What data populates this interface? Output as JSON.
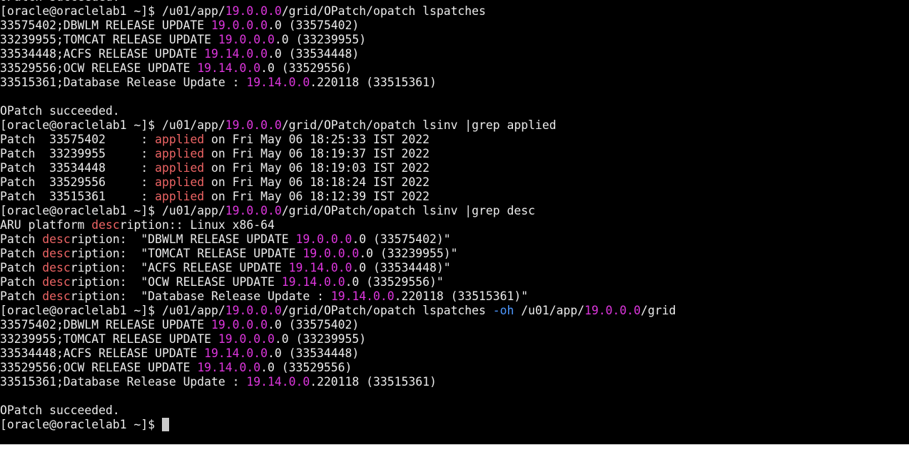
{
  "colors": {
    "background": "#000000",
    "text": "#ebebeb",
    "version": "#dd36dd",
    "match": "#ed6464",
    "option": "#4f99ff",
    "cursor": "#c9c9c9"
  },
  "terminal": {
    "lines": [
      [
        {
          "t": "OPatch succeeded."
        }
      ],
      [
        {
          "t": "[oracle@oraclelab1 ~]$ /u01/app/"
        },
        {
          "t": "19.0.0.0",
          "c": "v"
        },
        {
          "t": "/grid/OPatch/opatch lspatches"
        }
      ],
      [
        {
          "t": "33575402;DBWLM RELEASE UPDATE "
        },
        {
          "t": "19.0.0.0",
          "c": "v"
        },
        {
          "t": ".0 (33575402)"
        }
      ],
      [
        {
          "t": "33239955;TOMCAT RELEASE UPDATE "
        },
        {
          "t": "19.0.0.0",
          "c": "v"
        },
        {
          "t": ".0 (33239955)"
        }
      ],
      [
        {
          "t": "33534448;ACFS RELEASE UPDATE "
        },
        {
          "t": "19.14.0.0",
          "c": "v"
        },
        {
          "t": ".0 (33534448)"
        }
      ],
      [
        {
          "t": "33529556;OCW RELEASE UPDATE "
        },
        {
          "t": "19.14.0.0",
          "c": "v"
        },
        {
          "t": ".0 (33529556)"
        }
      ],
      [
        {
          "t": "33515361;Database Release Update : "
        },
        {
          "t": "19.14.0.0",
          "c": "v"
        },
        {
          "t": ".220118 (33515361)"
        }
      ],
      [],
      [
        {
          "t": "OPatch succeeded."
        }
      ],
      [
        {
          "t": "[oracle@oraclelab1 ~]$ /u01/app/"
        },
        {
          "t": "19.0.0.0",
          "c": "v"
        },
        {
          "t": "/grid/OPatch/opatch lsinv |grep applied"
        }
      ],
      [
        {
          "t": "Patch  33575402     : "
        },
        {
          "t": "applied",
          "c": "r"
        },
        {
          "t": " on Fri May 06 18:25:33 IST 2022"
        }
      ],
      [
        {
          "t": "Patch  33239955     : "
        },
        {
          "t": "applied",
          "c": "r"
        },
        {
          "t": " on Fri May 06 18:19:37 IST 2022"
        }
      ],
      [
        {
          "t": "Patch  33534448     : "
        },
        {
          "t": "applied",
          "c": "r"
        },
        {
          "t": " on Fri May 06 18:19:03 IST 2022"
        }
      ],
      [
        {
          "t": "Patch  33529556     : "
        },
        {
          "t": "applied",
          "c": "r"
        },
        {
          "t": " on Fri May 06 18:18:24 IST 2022"
        }
      ],
      [
        {
          "t": "Patch  33515361     : "
        },
        {
          "t": "applied",
          "c": "r"
        },
        {
          "t": " on Fri May 06 18:12:39 IST 2022"
        }
      ],
      [
        {
          "t": "[oracle@oraclelab1 ~]$ /u01/app/"
        },
        {
          "t": "19.0.0.0",
          "c": "v"
        },
        {
          "t": "/grid/OPatch/opatch lsinv |grep desc"
        }
      ],
      [
        {
          "t": "ARU platform "
        },
        {
          "t": "desc",
          "c": "r"
        },
        {
          "t": "ription:: Linux x86-64"
        }
      ],
      [
        {
          "t": "Patch "
        },
        {
          "t": "desc",
          "c": "r"
        },
        {
          "t": "ription:  \"DBWLM RELEASE UPDATE "
        },
        {
          "t": "19.0.0.0",
          "c": "v"
        },
        {
          "t": ".0 (33575402)\""
        }
      ],
      [
        {
          "t": "Patch "
        },
        {
          "t": "desc",
          "c": "r"
        },
        {
          "t": "ription:  \"TOMCAT RELEASE UPDATE "
        },
        {
          "t": "19.0.0.0",
          "c": "v"
        },
        {
          "t": ".0 (33239955)\""
        }
      ],
      [
        {
          "t": "Patch "
        },
        {
          "t": "desc",
          "c": "r"
        },
        {
          "t": "ription:  \"ACFS RELEASE UPDATE "
        },
        {
          "t": "19.14.0.0",
          "c": "v"
        },
        {
          "t": ".0 (33534448)\""
        }
      ],
      [
        {
          "t": "Patch "
        },
        {
          "t": "desc",
          "c": "r"
        },
        {
          "t": "ription:  \"OCW RELEASE UPDATE "
        },
        {
          "t": "19.14.0.0",
          "c": "v"
        },
        {
          "t": ".0 (33529556)\""
        }
      ],
      [
        {
          "t": "Patch "
        },
        {
          "t": "desc",
          "c": "r"
        },
        {
          "t": "ription:  \"Database Release Update : "
        },
        {
          "t": "19.14.0.0",
          "c": "v"
        },
        {
          "t": ".220118 (33515361)\""
        }
      ],
      [
        {
          "t": "[oracle@oraclelab1 ~]$ /u01/app/"
        },
        {
          "t": "19.0.0.0",
          "c": "v"
        },
        {
          "t": "/grid/OPatch/opatch lspatches "
        },
        {
          "t": "-oh",
          "c": "b"
        },
        {
          "t": " /u01/app/"
        },
        {
          "t": "19.0.0.0",
          "c": "v"
        },
        {
          "t": "/grid"
        }
      ],
      [
        {
          "t": "33575402;DBWLM RELEASE UPDATE "
        },
        {
          "t": "19.0.0.0",
          "c": "v"
        },
        {
          "t": ".0 (33575402)"
        }
      ],
      [
        {
          "t": "33239955;TOMCAT RELEASE UPDATE "
        },
        {
          "t": "19.0.0.0",
          "c": "v"
        },
        {
          "t": ".0 (33239955)"
        }
      ],
      [
        {
          "t": "33534448;ACFS RELEASE UPDATE "
        },
        {
          "t": "19.14.0.0",
          "c": "v"
        },
        {
          "t": ".0 (33534448)"
        }
      ],
      [
        {
          "t": "33529556;OCW RELEASE UPDATE "
        },
        {
          "t": "19.14.0.0",
          "c": "v"
        },
        {
          "t": ".0 (33529556)"
        }
      ],
      [
        {
          "t": "33515361;Database Release Update : "
        },
        {
          "t": "19.14.0.0",
          "c": "v"
        },
        {
          "t": ".220118 (33515361)"
        }
      ],
      [],
      [
        {
          "t": "OPatch succeeded."
        }
      ],
      [
        {
          "t": "[oracle@oraclelab1 ~]$ "
        }
      ]
    ]
  }
}
